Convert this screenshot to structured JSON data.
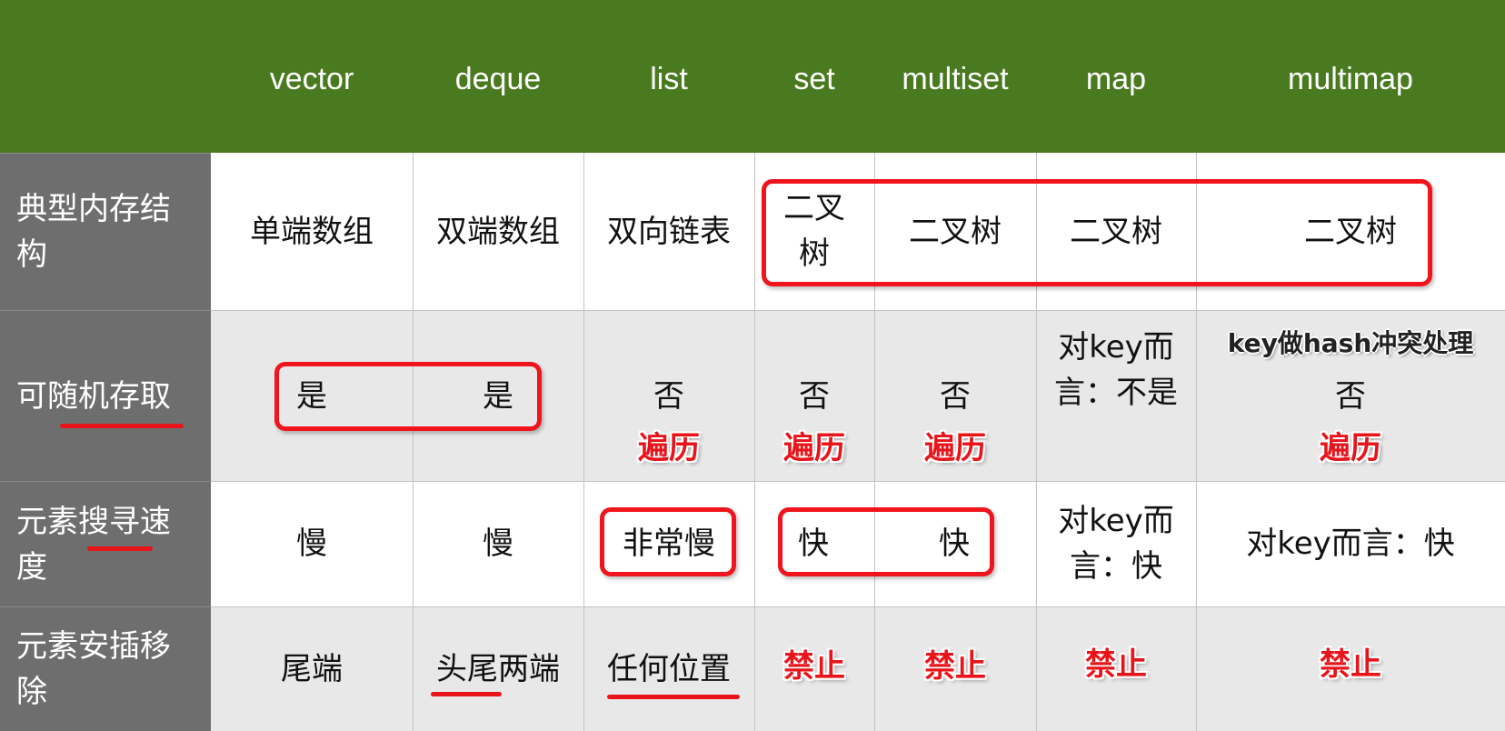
{
  "columns": [
    "vector",
    "deque",
    "list",
    "set",
    "multiset",
    "map",
    "multimap"
  ],
  "rows": [
    {
      "label": "典型内存结构",
      "cells": [
        "单端数组",
        "双端数组",
        "双向链表",
        "二叉树",
        "二叉树",
        "二叉树",
        "二叉树"
      ]
    },
    {
      "label": "可随机存取",
      "cells": [
        "是",
        "是",
        "否",
        "否",
        "否",
        "对key而言：不是",
        "否"
      ],
      "notes": [
        "",
        "",
        "遍历",
        "遍历",
        "遍历",
        "",
        "遍历"
      ],
      "multimap_note": "key做hash冲突处理"
    },
    {
      "label": "元素搜寻速度",
      "cells": [
        "慢",
        "慢",
        "非常慢",
        "快",
        "快",
        "对key而言：快",
        "对key而言：快"
      ]
    },
    {
      "label": "元素安插移除",
      "cells": [
        "尾端",
        "头尾两端",
        "任何位置",
        "禁止",
        "禁止",
        "禁止",
        "禁止"
      ]
    }
  ],
  "colors": {
    "header_bg": "#4a7a1f",
    "label_bg": "#6e6e6e",
    "shaded_row_bg": "#e8e8e8",
    "highlight_red": "#e8141a"
  }
}
